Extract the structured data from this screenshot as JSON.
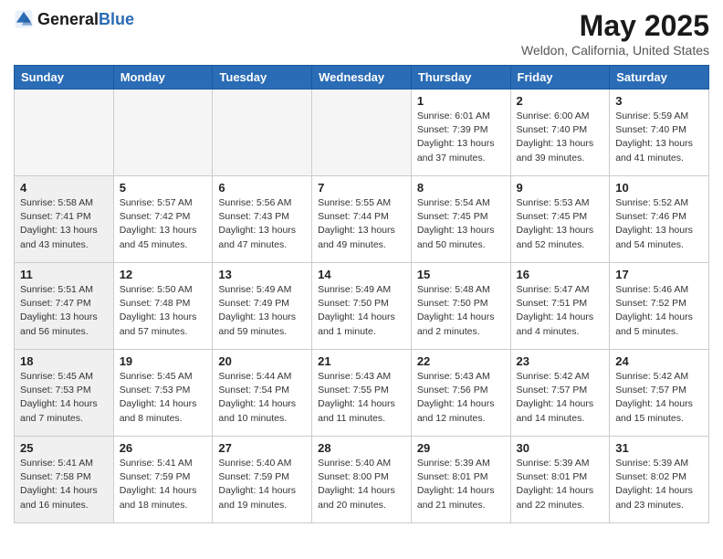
{
  "header": {
    "logo_general": "General",
    "logo_blue": "Blue",
    "title": "May 2025",
    "subtitle": "Weldon, California, United States"
  },
  "weekdays": [
    "Sunday",
    "Monday",
    "Tuesday",
    "Wednesday",
    "Thursday",
    "Friday",
    "Saturday"
  ],
  "weeks": [
    [
      {
        "day": "",
        "info": "",
        "shaded": true
      },
      {
        "day": "",
        "info": "",
        "shaded": true
      },
      {
        "day": "",
        "info": "",
        "shaded": true
      },
      {
        "day": "",
        "info": "",
        "shaded": true
      },
      {
        "day": "1",
        "info": "Sunrise: 6:01 AM\nSunset: 7:39 PM\nDaylight: 13 hours\nand 37 minutes.",
        "shaded": false
      },
      {
        "day": "2",
        "info": "Sunrise: 6:00 AM\nSunset: 7:40 PM\nDaylight: 13 hours\nand 39 minutes.",
        "shaded": false
      },
      {
        "day": "3",
        "info": "Sunrise: 5:59 AM\nSunset: 7:40 PM\nDaylight: 13 hours\nand 41 minutes.",
        "shaded": false
      }
    ],
    [
      {
        "day": "4",
        "info": "Sunrise: 5:58 AM\nSunset: 7:41 PM\nDaylight: 13 hours\nand 43 minutes.",
        "shaded": true
      },
      {
        "day": "5",
        "info": "Sunrise: 5:57 AM\nSunset: 7:42 PM\nDaylight: 13 hours\nand 45 minutes.",
        "shaded": false
      },
      {
        "day": "6",
        "info": "Sunrise: 5:56 AM\nSunset: 7:43 PM\nDaylight: 13 hours\nand 47 minutes.",
        "shaded": false
      },
      {
        "day": "7",
        "info": "Sunrise: 5:55 AM\nSunset: 7:44 PM\nDaylight: 13 hours\nand 49 minutes.",
        "shaded": false
      },
      {
        "day": "8",
        "info": "Sunrise: 5:54 AM\nSunset: 7:45 PM\nDaylight: 13 hours\nand 50 minutes.",
        "shaded": false
      },
      {
        "day": "9",
        "info": "Sunrise: 5:53 AM\nSunset: 7:45 PM\nDaylight: 13 hours\nand 52 minutes.",
        "shaded": false
      },
      {
        "day": "10",
        "info": "Sunrise: 5:52 AM\nSunset: 7:46 PM\nDaylight: 13 hours\nand 54 minutes.",
        "shaded": false
      }
    ],
    [
      {
        "day": "11",
        "info": "Sunrise: 5:51 AM\nSunset: 7:47 PM\nDaylight: 13 hours\nand 56 minutes.",
        "shaded": true
      },
      {
        "day": "12",
        "info": "Sunrise: 5:50 AM\nSunset: 7:48 PM\nDaylight: 13 hours\nand 57 minutes.",
        "shaded": false
      },
      {
        "day": "13",
        "info": "Sunrise: 5:49 AM\nSunset: 7:49 PM\nDaylight: 13 hours\nand 59 minutes.",
        "shaded": false
      },
      {
        "day": "14",
        "info": "Sunrise: 5:49 AM\nSunset: 7:50 PM\nDaylight: 14 hours\nand 1 minute.",
        "shaded": false
      },
      {
        "day": "15",
        "info": "Sunrise: 5:48 AM\nSunset: 7:50 PM\nDaylight: 14 hours\nand 2 minutes.",
        "shaded": false
      },
      {
        "day": "16",
        "info": "Sunrise: 5:47 AM\nSunset: 7:51 PM\nDaylight: 14 hours\nand 4 minutes.",
        "shaded": false
      },
      {
        "day": "17",
        "info": "Sunrise: 5:46 AM\nSunset: 7:52 PM\nDaylight: 14 hours\nand 5 minutes.",
        "shaded": false
      }
    ],
    [
      {
        "day": "18",
        "info": "Sunrise: 5:45 AM\nSunset: 7:53 PM\nDaylight: 14 hours\nand 7 minutes.",
        "shaded": true
      },
      {
        "day": "19",
        "info": "Sunrise: 5:45 AM\nSunset: 7:53 PM\nDaylight: 14 hours\nand 8 minutes.",
        "shaded": false
      },
      {
        "day": "20",
        "info": "Sunrise: 5:44 AM\nSunset: 7:54 PM\nDaylight: 14 hours\nand 10 minutes.",
        "shaded": false
      },
      {
        "day": "21",
        "info": "Sunrise: 5:43 AM\nSunset: 7:55 PM\nDaylight: 14 hours\nand 11 minutes.",
        "shaded": false
      },
      {
        "day": "22",
        "info": "Sunrise: 5:43 AM\nSunset: 7:56 PM\nDaylight: 14 hours\nand 12 minutes.",
        "shaded": false
      },
      {
        "day": "23",
        "info": "Sunrise: 5:42 AM\nSunset: 7:57 PM\nDaylight: 14 hours\nand 14 minutes.",
        "shaded": false
      },
      {
        "day": "24",
        "info": "Sunrise: 5:42 AM\nSunset: 7:57 PM\nDaylight: 14 hours\nand 15 minutes.",
        "shaded": false
      }
    ],
    [
      {
        "day": "25",
        "info": "Sunrise: 5:41 AM\nSunset: 7:58 PM\nDaylight: 14 hours\nand 16 minutes.",
        "shaded": true
      },
      {
        "day": "26",
        "info": "Sunrise: 5:41 AM\nSunset: 7:59 PM\nDaylight: 14 hours\nand 18 minutes.",
        "shaded": false
      },
      {
        "day": "27",
        "info": "Sunrise: 5:40 AM\nSunset: 7:59 PM\nDaylight: 14 hours\nand 19 minutes.",
        "shaded": false
      },
      {
        "day": "28",
        "info": "Sunrise: 5:40 AM\nSunset: 8:00 PM\nDaylight: 14 hours\nand 20 minutes.",
        "shaded": false
      },
      {
        "day": "29",
        "info": "Sunrise: 5:39 AM\nSunset: 8:01 PM\nDaylight: 14 hours\nand 21 minutes.",
        "shaded": false
      },
      {
        "day": "30",
        "info": "Sunrise: 5:39 AM\nSunset: 8:01 PM\nDaylight: 14 hours\nand 22 minutes.",
        "shaded": false
      },
      {
        "day": "31",
        "info": "Sunrise: 5:39 AM\nSunset: 8:02 PM\nDaylight: 14 hours\nand 23 minutes.",
        "shaded": false
      }
    ]
  ]
}
